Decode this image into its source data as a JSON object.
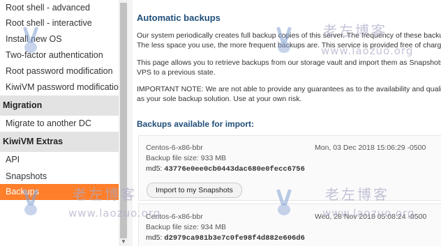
{
  "sidebar": {
    "items_top": [
      "Root shell - advanced",
      "Root shell - interactive",
      "Install new OS",
      "Two-factor authentication",
      "Root password modification",
      "KiwiVM password modification"
    ],
    "migration_header": "Migration",
    "migration_items": [
      "Migrate to another DC"
    ],
    "extras_header": "KiwiVM Extras",
    "extras_items": [
      "API",
      "Snapshots",
      "Backups"
    ],
    "active_item": "Backups",
    "accent": "#ff7f2a"
  },
  "main": {
    "title": "Automatic backups",
    "paragraphs": [
      "Our system periodically creates full backup copies of this server. The frequency of these backu",
      "The less space you use, the more frequent backups are. This service is provided free of charge",
      "This page allows you to retrieve backups from our storage vault and import them as Snapshots",
      "VPS to a previous state.",
      "IMPORTANT NOTE: We are not able to provide any guarantees as to the availability and quality",
      "as your sole backup solution. Use at your own risk."
    ],
    "backups_header": "Backups available for import:",
    "backups": [
      {
        "os": "Centos-6-x86-bbr",
        "date": "Mon, 03 Dec 2018 15:06:29 -0500",
        "size": "Backup file size: 933 MB",
        "md5_label": "md5:",
        "md5": "43776e0ee0cb0443dac680e0fecc6756",
        "button": "Import to my Snapshots"
      },
      {
        "os": "Centos-6-x86-bbr",
        "date": "Wed, 28 Nov 2018 05:08:24 -0500",
        "size": "Backup file size: 934 MB",
        "md5_label": "md5:",
        "md5": "d2979ca981b3e7c0fe98f4d882e606d6"
      }
    ]
  },
  "watermark": {
    "cn": "老左博客",
    "url": "www.laozuo.org"
  }
}
